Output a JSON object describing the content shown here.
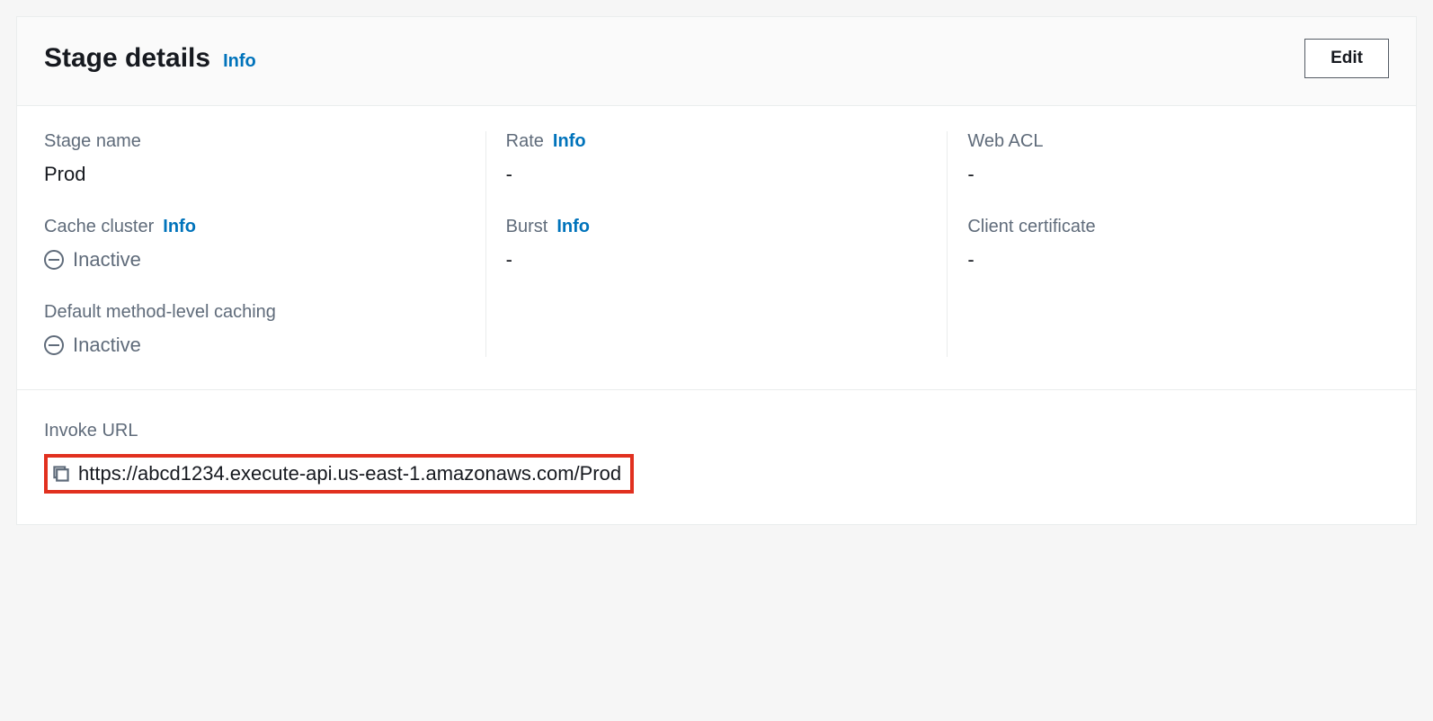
{
  "header": {
    "title": "Stage details",
    "info_label": "Info",
    "edit_label": "Edit"
  },
  "fields": {
    "stage_name": {
      "label": "Stage name",
      "value": "Prod"
    },
    "cache_cluster": {
      "label": "Cache cluster",
      "info": "Info",
      "status": "Inactive"
    },
    "method_caching": {
      "label": "Default method-level caching",
      "status": "Inactive"
    },
    "rate": {
      "label": "Rate",
      "info": "Info",
      "value": "-"
    },
    "burst": {
      "label": "Burst",
      "info": "Info",
      "value": "-"
    },
    "web_acl": {
      "label": "Web ACL",
      "value": "-"
    },
    "client_cert": {
      "label": "Client certificate",
      "value": "-"
    }
  },
  "invoke_url": {
    "label": "Invoke URL",
    "value": "https://abcd1234.execute-api.us-east-1.amazonaws.com/Prod"
  }
}
